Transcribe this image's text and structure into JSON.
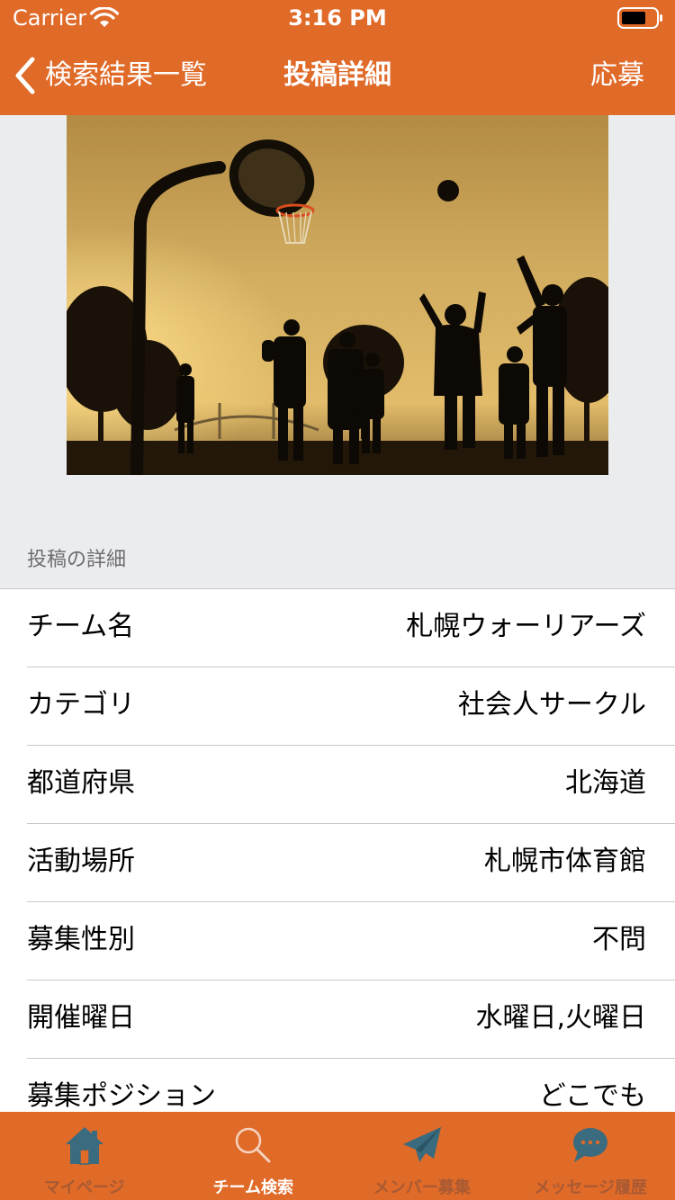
{
  "theme": {
    "accent": "#e06a28",
    "tab_icon_inactive": "#3a6b7e",
    "tab_icon_active": "#f5d3c0"
  },
  "status_bar": {
    "carrier": "Carrier",
    "time": "3:16 PM",
    "icons": [
      "wifi-icon",
      "battery-icon"
    ]
  },
  "nav_bar": {
    "back_label": "検索結果一覧",
    "title": "投稿詳細",
    "right_button": "応募"
  },
  "hero_image": {
    "description_icon": "basketball-photo"
  },
  "details": {
    "section_header": "投稿の詳細",
    "rows": [
      {
        "label": "チーム名",
        "value": "札幌ウォーリアーズ"
      },
      {
        "label": "カテゴリ",
        "value": "社会人サークル"
      },
      {
        "label": "都道府県",
        "value": "北海道"
      },
      {
        "label": "活動場所",
        "value": "札幌市体育館"
      },
      {
        "label": "募集性別",
        "value": "不問"
      },
      {
        "label": "開催曜日",
        "value": "水曜日,火曜日"
      },
      {
        "label": "募集ポジション",
        "value": "どこでも"
      }
    ]
  },
  "tab_bar": {
    "selected_index": 1,
    "tabs": [
      {
        "label": "マイページ",
        "icon": "home-icon"
      },
      {
        "label": "チーム検索",
        "icon": "search-icon"
      },
      {
        "label": "メンバー募集",
        "icon": "paper-plane-icon"
      },
      {
        "label": "メッセージ履歴",
        "icon": "chat-bubble-icon"
      }
    ]
  }
}
